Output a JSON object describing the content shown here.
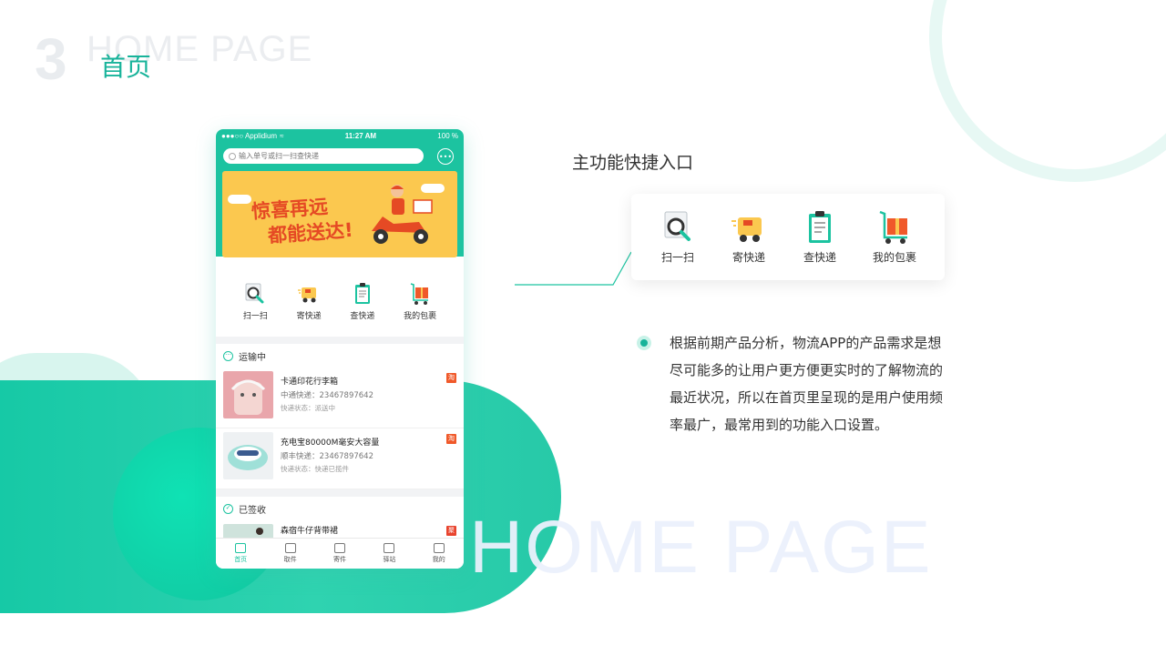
{
  "header": {
    "number": "3",
    "bg_title": "HOME PAGE",
    "title": "首页"
  },
  "watermark": "HOME PAGE",
  "colors": {
    "accent": "#1cc3a0",
    "title": "#17b39a",
    "banner": "#fbc84f"
  },
  "phone": {
    "status": {
      "carrier": "●●●○○ Applidium",
      "time": "11:27 AM",
      "battery": "100 %"
    },
    "search": {
      "placeholder": "输入单号或扫一扫查快递",
      "icon": "search-icon"
    },
    "message_icon": "chat-icon",
    "banner": {
      "line1": "惊喜再远",
      "line2": "都能送达!"
    },
    "shortcuts": [
      {
        "label": "扫一扫",
        "icon": "scan-magnifier-icon"
      },
      {
        "label": "寄快递",
        "icon": "delivery-truck-icon"
      },
      {
        "label": "查快递",
        "icon": "clipboard-icon"
      },
      {
        "label": "我的包裹",
        "icon": "parcel-cart-icon"
      }
    ],
    "in_transit": {
      "title": "运输中",
      "items": [
        {
          "name": "卡通印花行李箱",
          "number": "中通快递：23467897642",
          "status": "快递状态：派送中",
          "tag": "淘"
        },
        {
          "name": "充电宝80000M毫安大容量",
          "number": "顺丰快递：23467897642",
          "status": "快递状态：快递已揽件",
          "tag": "淘"
        }
      ]
    },
    "signed": {
      "title": "已签收",
      "items": [
        {
          "name": "森宿牛仔背带裙",
          "tag": "聚"
        }
      ]
    },
    "tabs": [
      {
        "label": "首页",
        "icon": "home-icon",
        "active": true
      },
      {
        "label": "取件",
        "icon": "pickup-icon",
        "active": false
      },
      {
        "label": "寄件",
        "icon": "send-icon",
        "active": false
      },
      {
        "label": "驿站",
        "icon": "station-icon",
        "active": false
      },
      {
        "label": "我的",
        "icon": "profile-icon",
        "active": false
      }
    ]
  },
  "feature": {
    "title": "主功能快捷入口",
    "items": [
      {
        "label": "扫一扫",
        "icon": "scan-magnifier-icon"
      },
      {
        "label": "寄快递",
        "icon": "delivery-truck-icon"
      },
      {
        "label": "查快递",
        "icon": "clipboard-icon"
      },
      {
        "label": "我的包裹",
        "icon": "parcel-cart-icon"
      }
    ]
  },
  "description": "根据前期产品分析，物流APP的产品需求是想尽可能多的让用户更方便更实时的了解物流的最近状况，所以在首页里呈现的是用户使用频率最广，最常用到的功能入口设置。"
}
